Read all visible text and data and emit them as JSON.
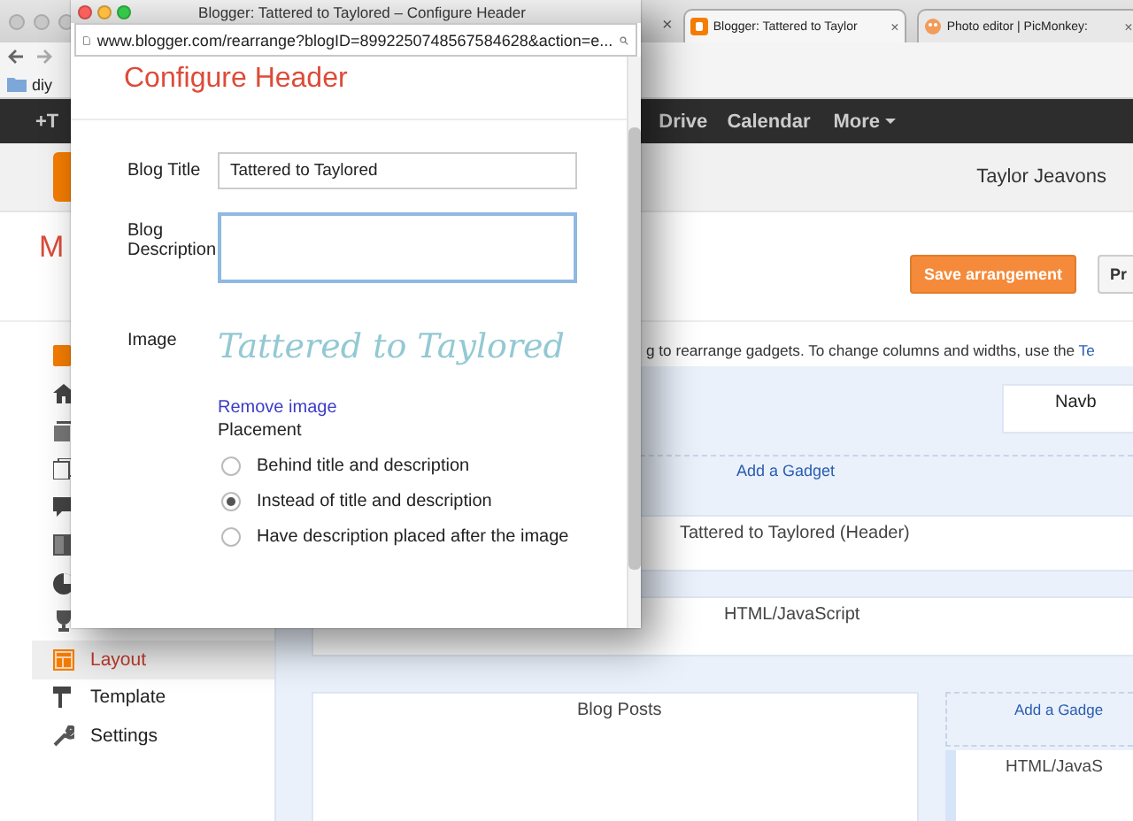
{
  "browser": {
    "hidden_tab_close": "×",
    "tabs": [
      {
        "label": "Blogger: Tattered to Taylor",
        "close": "×",
        "selected": true
      },
      {
        "label": "Photo editor | PicMonkey:",
        "close": "×",
        "selected": false
      }
    ],
    "bookmarks": [
      "diy"
    ]
  },
  "google_bar": {
    "items": [
      "+T",
      "Drive",
      "Calendar",
      "More"
    ]
  },
  "blogger": {
    "user": "Taylor Jeavons",
    "heading": "M",
    "buttons": [
      {
        "label": "Save arrangement",
        "kind": "primary"
      },
      {
        "label": "Pr",
        "kind": "plain"
      }
    ],
    "sidebar": {
      "items": [
        {
          "selected": false
        },
        {
          "selected": false
        },
        {
          "selected": false
        },
        {
          "selected": false
        },
        {
          "selected": false
        },
        {
          "selected": false
        },
        {
          "selected": false
        },
        {
          "selected": false
        },
        {
          "label": "Layout",
          "selected": true
        },
        {
          "label": "Template",
          "selected": false
        },
        {
          "label": "Settings",
          "selected": false
        }
      ]
    },
    "instructions": {
      "text": "g to rearrange gadgets. To change columns and widths, use the ",
      "link": "Te"
    },
    "layout": {
      "navbar": "Navb",
      "add_gadget": "Add a Gadget",
      "header": "Tattered to Taylored (Header)",
      "html_gadget": "HTML/JavaScript",
      "blog_posts": "Blog Posts",
      "side_add_gadget": "Add a Gadge",
      "side_html_gadget": "HTML/JavaS"
    }
  },
  "popup": {
    "window_title": "Blogger: Tattered to Taylored – Configure Header",
    "url": "www.blogger.com/rearrange?blogID=8992250748567584628&action=e...",
    "heading": "Configure Header",
    "fields": [
      {
        "label": "Blog Title",
        "kind": "text",
        "value": "Tattered to Taylored",
        "focused": false
      },
      {
        "label": "Blog Description",
        "kind": "textarea",
        "focused": true
      }
    ],
    "image": {
      "label": "Image",
      "image_text": "Tattered to Taylored",
      "remove_link": "Remove image"
    },
    "placement": {
      "label": "Placement",
      "options": [
        {
          "label": "Behind title and description",
          "selected": false
        },
        {
          "label": "Instead of title and description",
          "selected": true
        },
        {
          "label": "Have description placed after the image",
          "selected": false
        }
      ]
    }
  }
}
